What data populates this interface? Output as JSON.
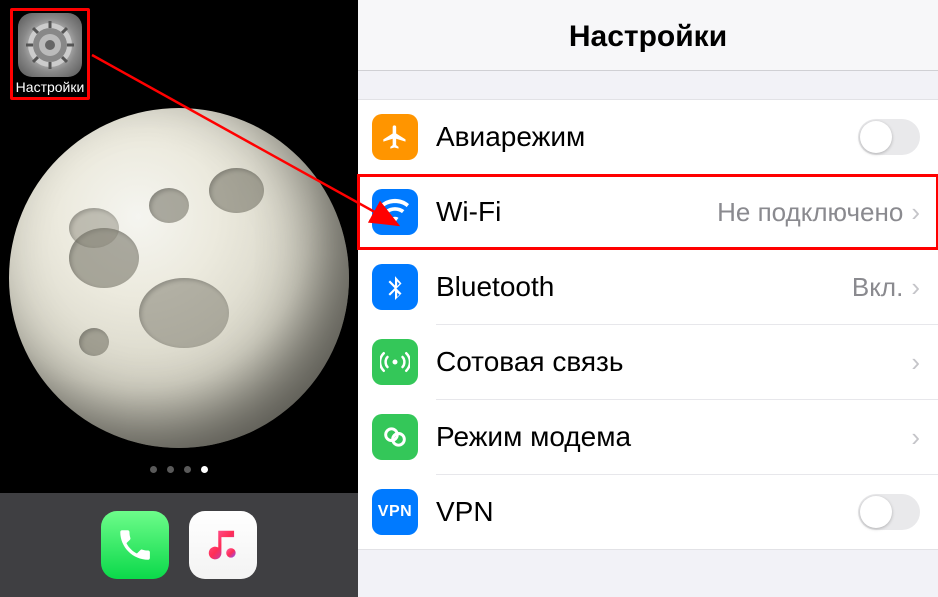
{
  "home": {
    "settings_app_label": "Настройки",
    "page_dots_total": 4,
    "page_dots_active": 3
  },
  "settings": {
    "title": "Настройки",
    "rows": {
      "airplane": {
        "label": "Авиарежим",
        "toggle": "off"
      },
      "wifi": {
        "label": "Wi-Fi",
        "value": "Не подключено"
      },
      "bluetooth": {
        "label": "Bluetooth",
        "value": "Вкл."
      },
      "cellular": {
        "label": "Сотовая связь"
      },
      "hotspot": {
        "label": "Режим модема"
      },
      "vpn": {
        "label": "VPN",
        "badge": "VPN",
        "toggle": "off"
      }
    }
  }
}
